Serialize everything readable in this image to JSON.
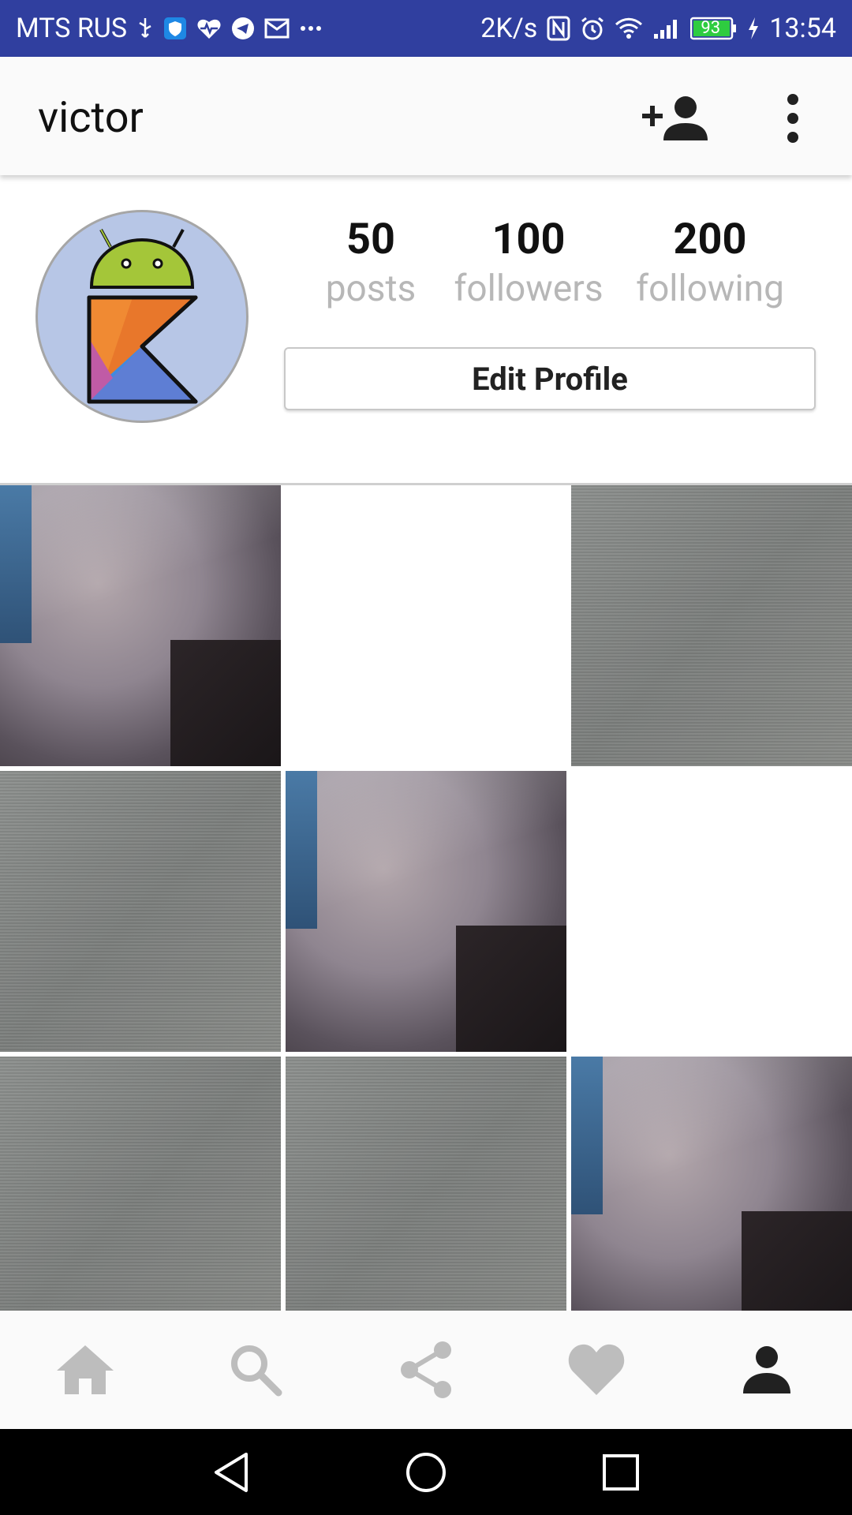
{
  "status_bar": {
    "carrier": "MTS RUS",
    "network_speed": "2K/s",
    "battery_level": "93",
    "time": "13:54"
  },
  "app_bar": {
    "title": "victor",
    "icons": [
      "add-person-icon",
      "more-vertical-icon"
    ]
  },
  "profile": {
    "stats": [
      {
        "value": "50",
        "label": "posts"
      },
      {
        "value": "100",
        "label": "followers"
      },
      {
        "value": "200",
        "label": "following"
      }
    ],
    "edit_button_label": "Edit Profile"
  },
  "grid": {
    "photos": [
      "pillow",
      "blank",
      "texture",
      "texture",
      "pillow",
      "blank",
      "texture",
      "texture",
      "pillow"
    ]
  },
  "bottom_nav": {
    "items": [
      "home-icon",
      "search-icon",
      "share-icon",
      "heart-icon",
      "profile-icon"
    ],
    "active": "profile-icon"
  },
  "system_nav": [
    "back-icon",
    "home-circle-icon",
    "recents-icon"
  ],
  "colors": {
    "status_bar": "#303f9f",
    "nav_inactive": "#bdbdbd",
    "nav_active": "#212121"
  }
}
